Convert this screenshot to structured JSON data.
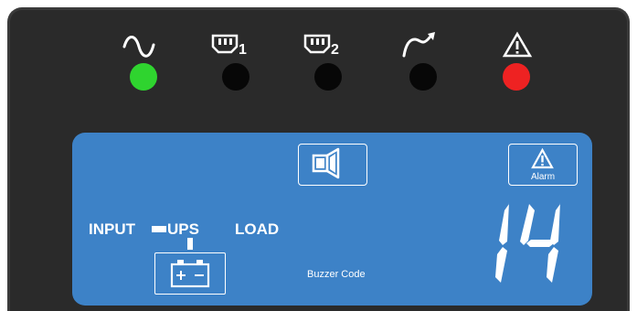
{
  "indicators": [
    {
      "name": "ac-input",
      "icon": "sine-wave-icon",
      "led_state": "on",
      "led_color": "#2fd42f"
    },
    {
      "name": "outlet-group-1",
      "icon": "outlet-1-icon",
      "led_state": "off",
      "label": "1",
      "led_color": "#070707"
    },
    {
      "name": "outlet-group-2",
      "icon": "outlet-2-icon",
      "led_state": "off",
      "label": "2",
      "led_color": "#070707"
    },
    {
      "name": "bypass",
      "icon": "bypass-arrow-icon",
      "led_state": "off",
      "led_color": "#070707"
    },
    {
      "name": "fault",
      "icon": "warning-triangle-icon",
      "led_state": "on",
      "led_color": "#ee2222"
    }
  ],
  "lcd": {
    "background": "#3d82c7",
    "mute_button_icon": "speaker-icon",
    "alarm_label": "Alarm",
    "input_label": "INPUT",
    "ups_label": "UPS",
    "load_label": "LOAD",
    "buzzer_label": "Buzzer Code",
    "code_value": "14"
  }
}
